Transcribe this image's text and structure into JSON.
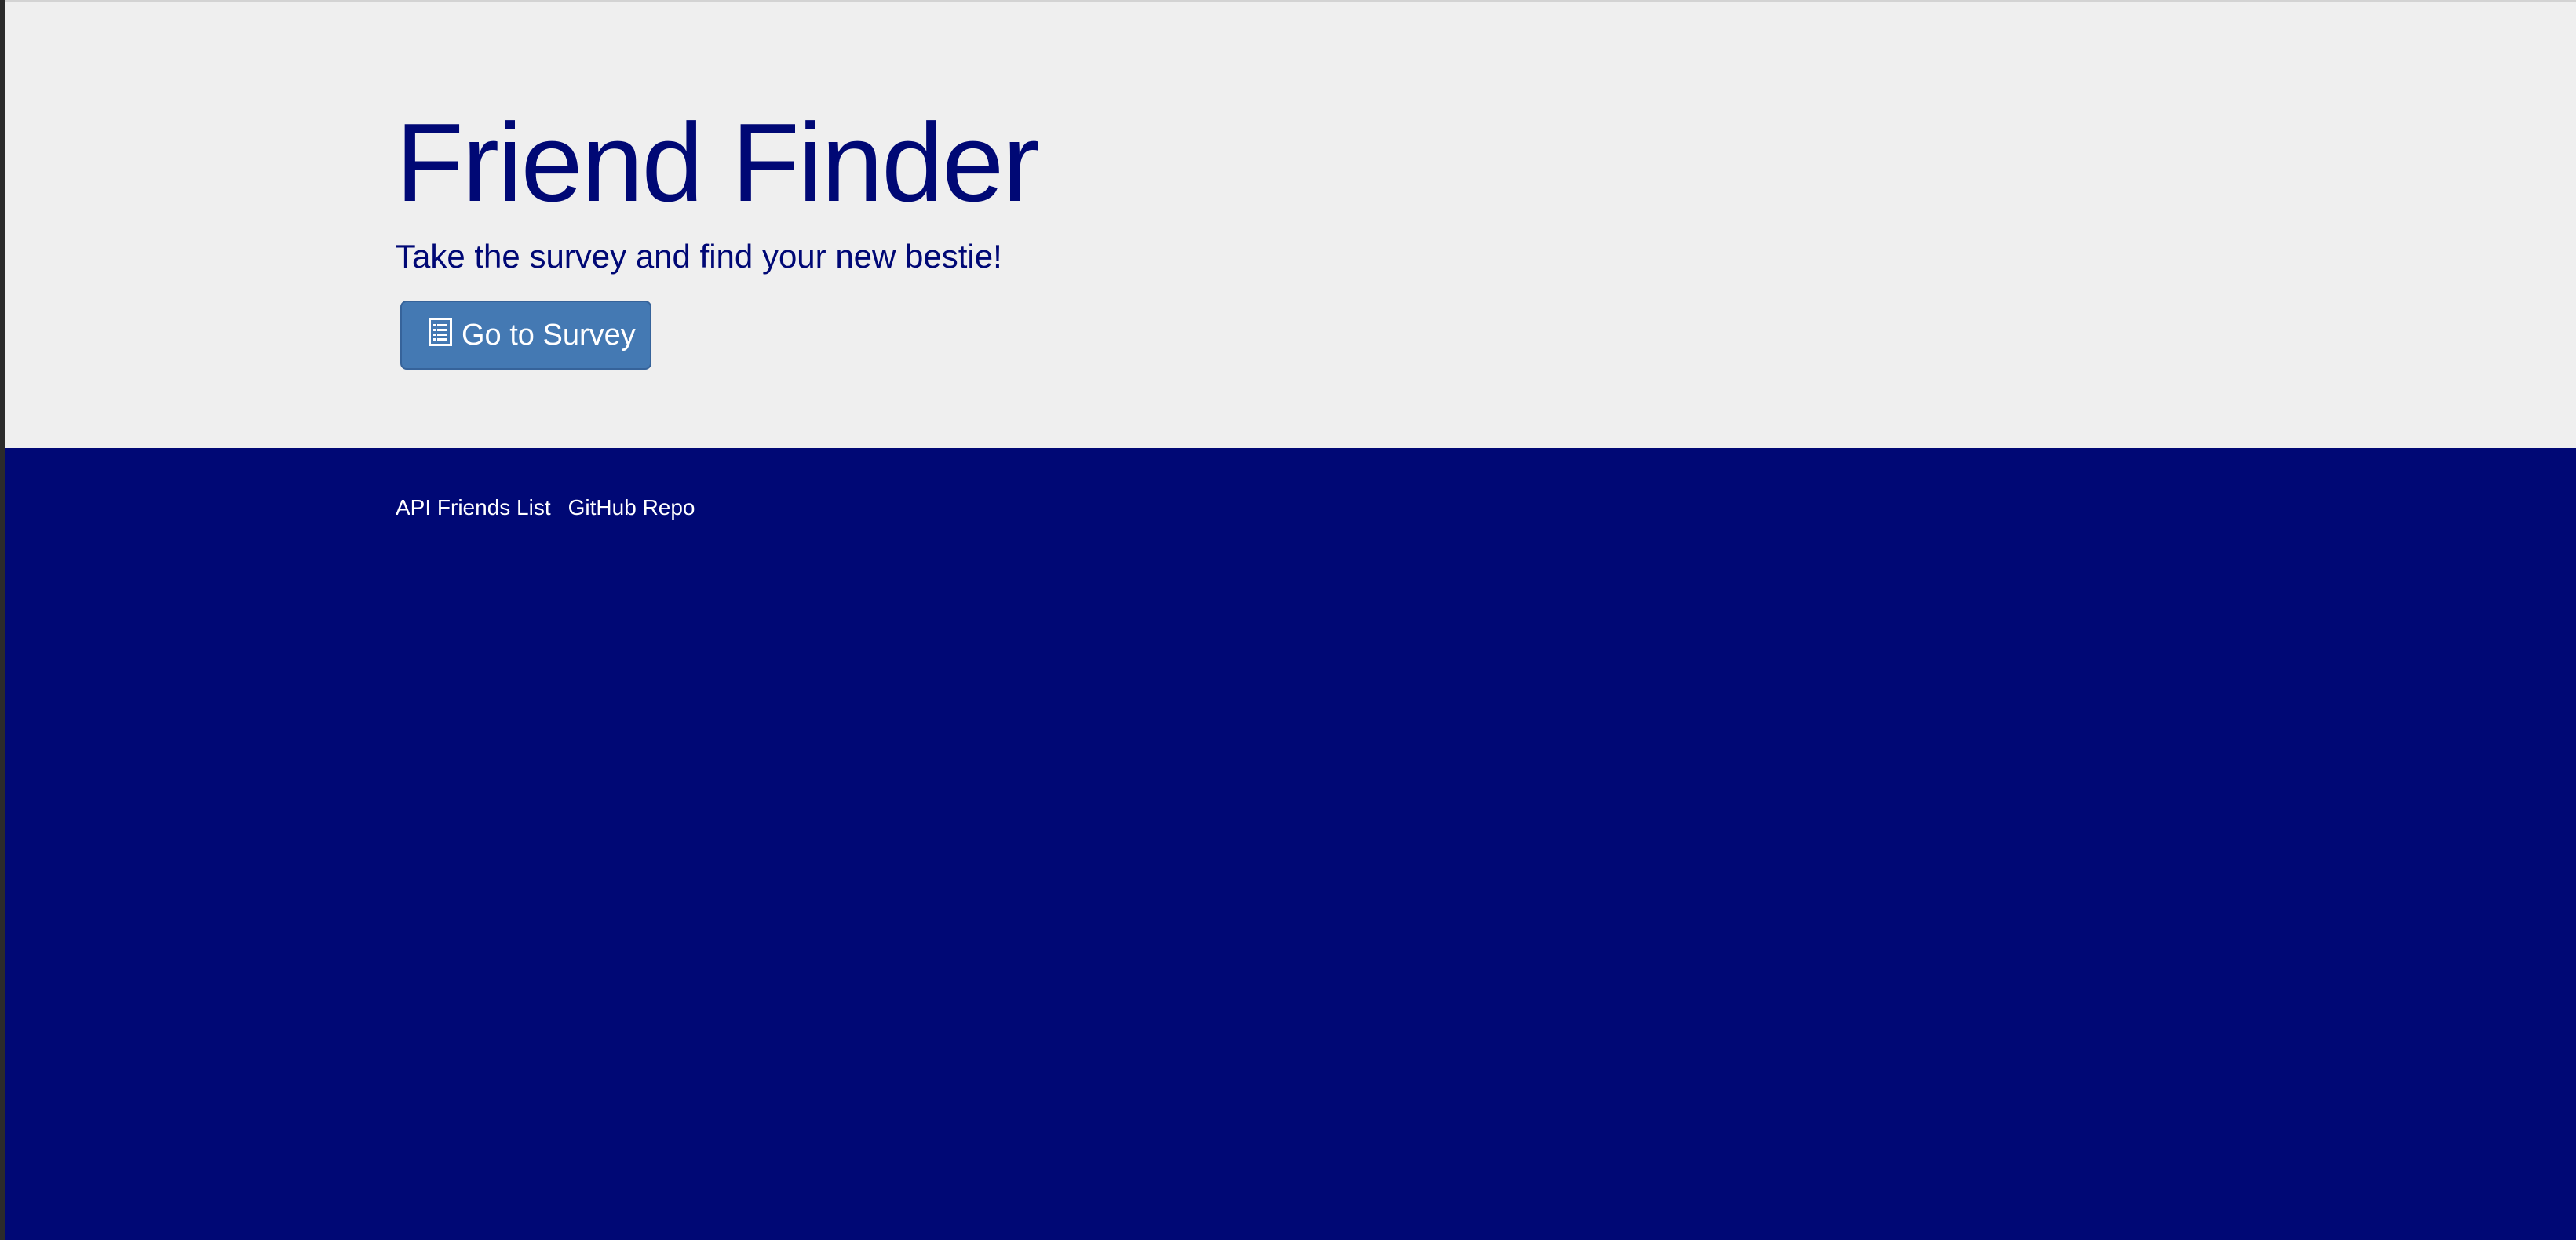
{
  "hero": {
    "title": "Friend Finder",
    "subtitle": "Take the survey and find your new bestie!",
    "survey_button": {
      "label": "Go to Survey",
      "icon": "list-alt-icon"
    }
  },
  "footer": {
    "links": [
      {
        "label": "API Friends List"
      },
      {
        "label": "GitHub Repo"
      }
    ]
  },
  "colors": {
    "brand_navy": "#000875",
    "jumbotron_bg": "#efefef",
    "button_blue": "#4479b3"
  }
}
